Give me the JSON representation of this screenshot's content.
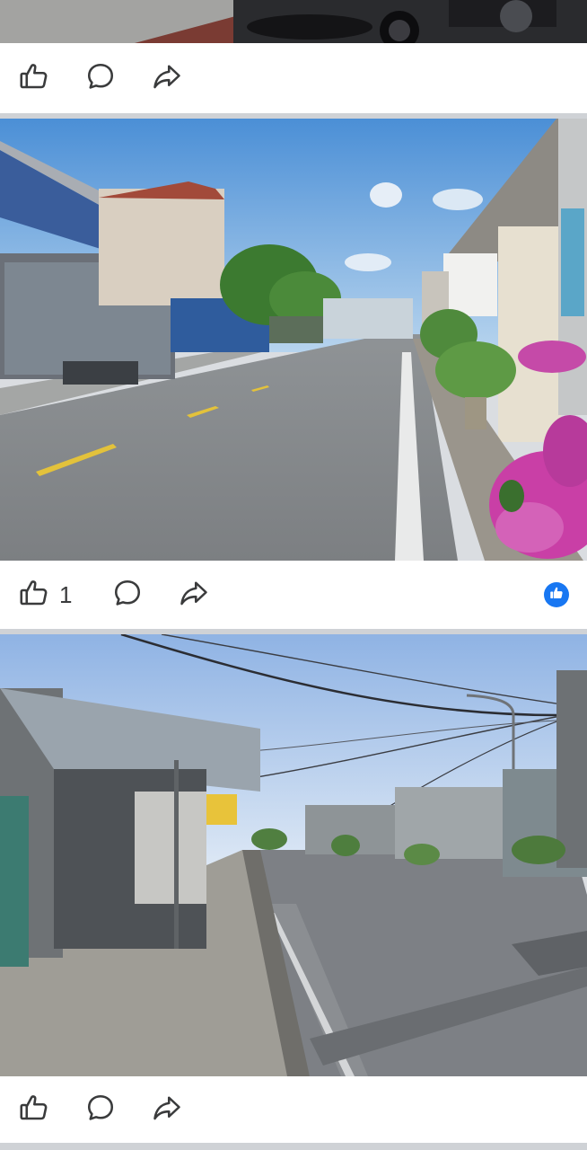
{
  "posts": [
    {
      "actions": {
        "like_count": ""
      }
    },
    {
      "actions": {
        "like_count": "1"
      },
      "reaction": "like-reaction-badge"
    },
    {
      "actions": {
        "like_count": ""
      }
    }
  ],
  "icons": {
    "like": "thumbs-up-icon",
    "comment": "comment-bubble-icon",
    "share": "share-arrow-icon"
  },
  "colors": {
    "icon": "#3a3b3c",
    "reaction_blue": "#1877f2",
    "background": "#dadde1",
    "card": "#ffffff"
  }
}
